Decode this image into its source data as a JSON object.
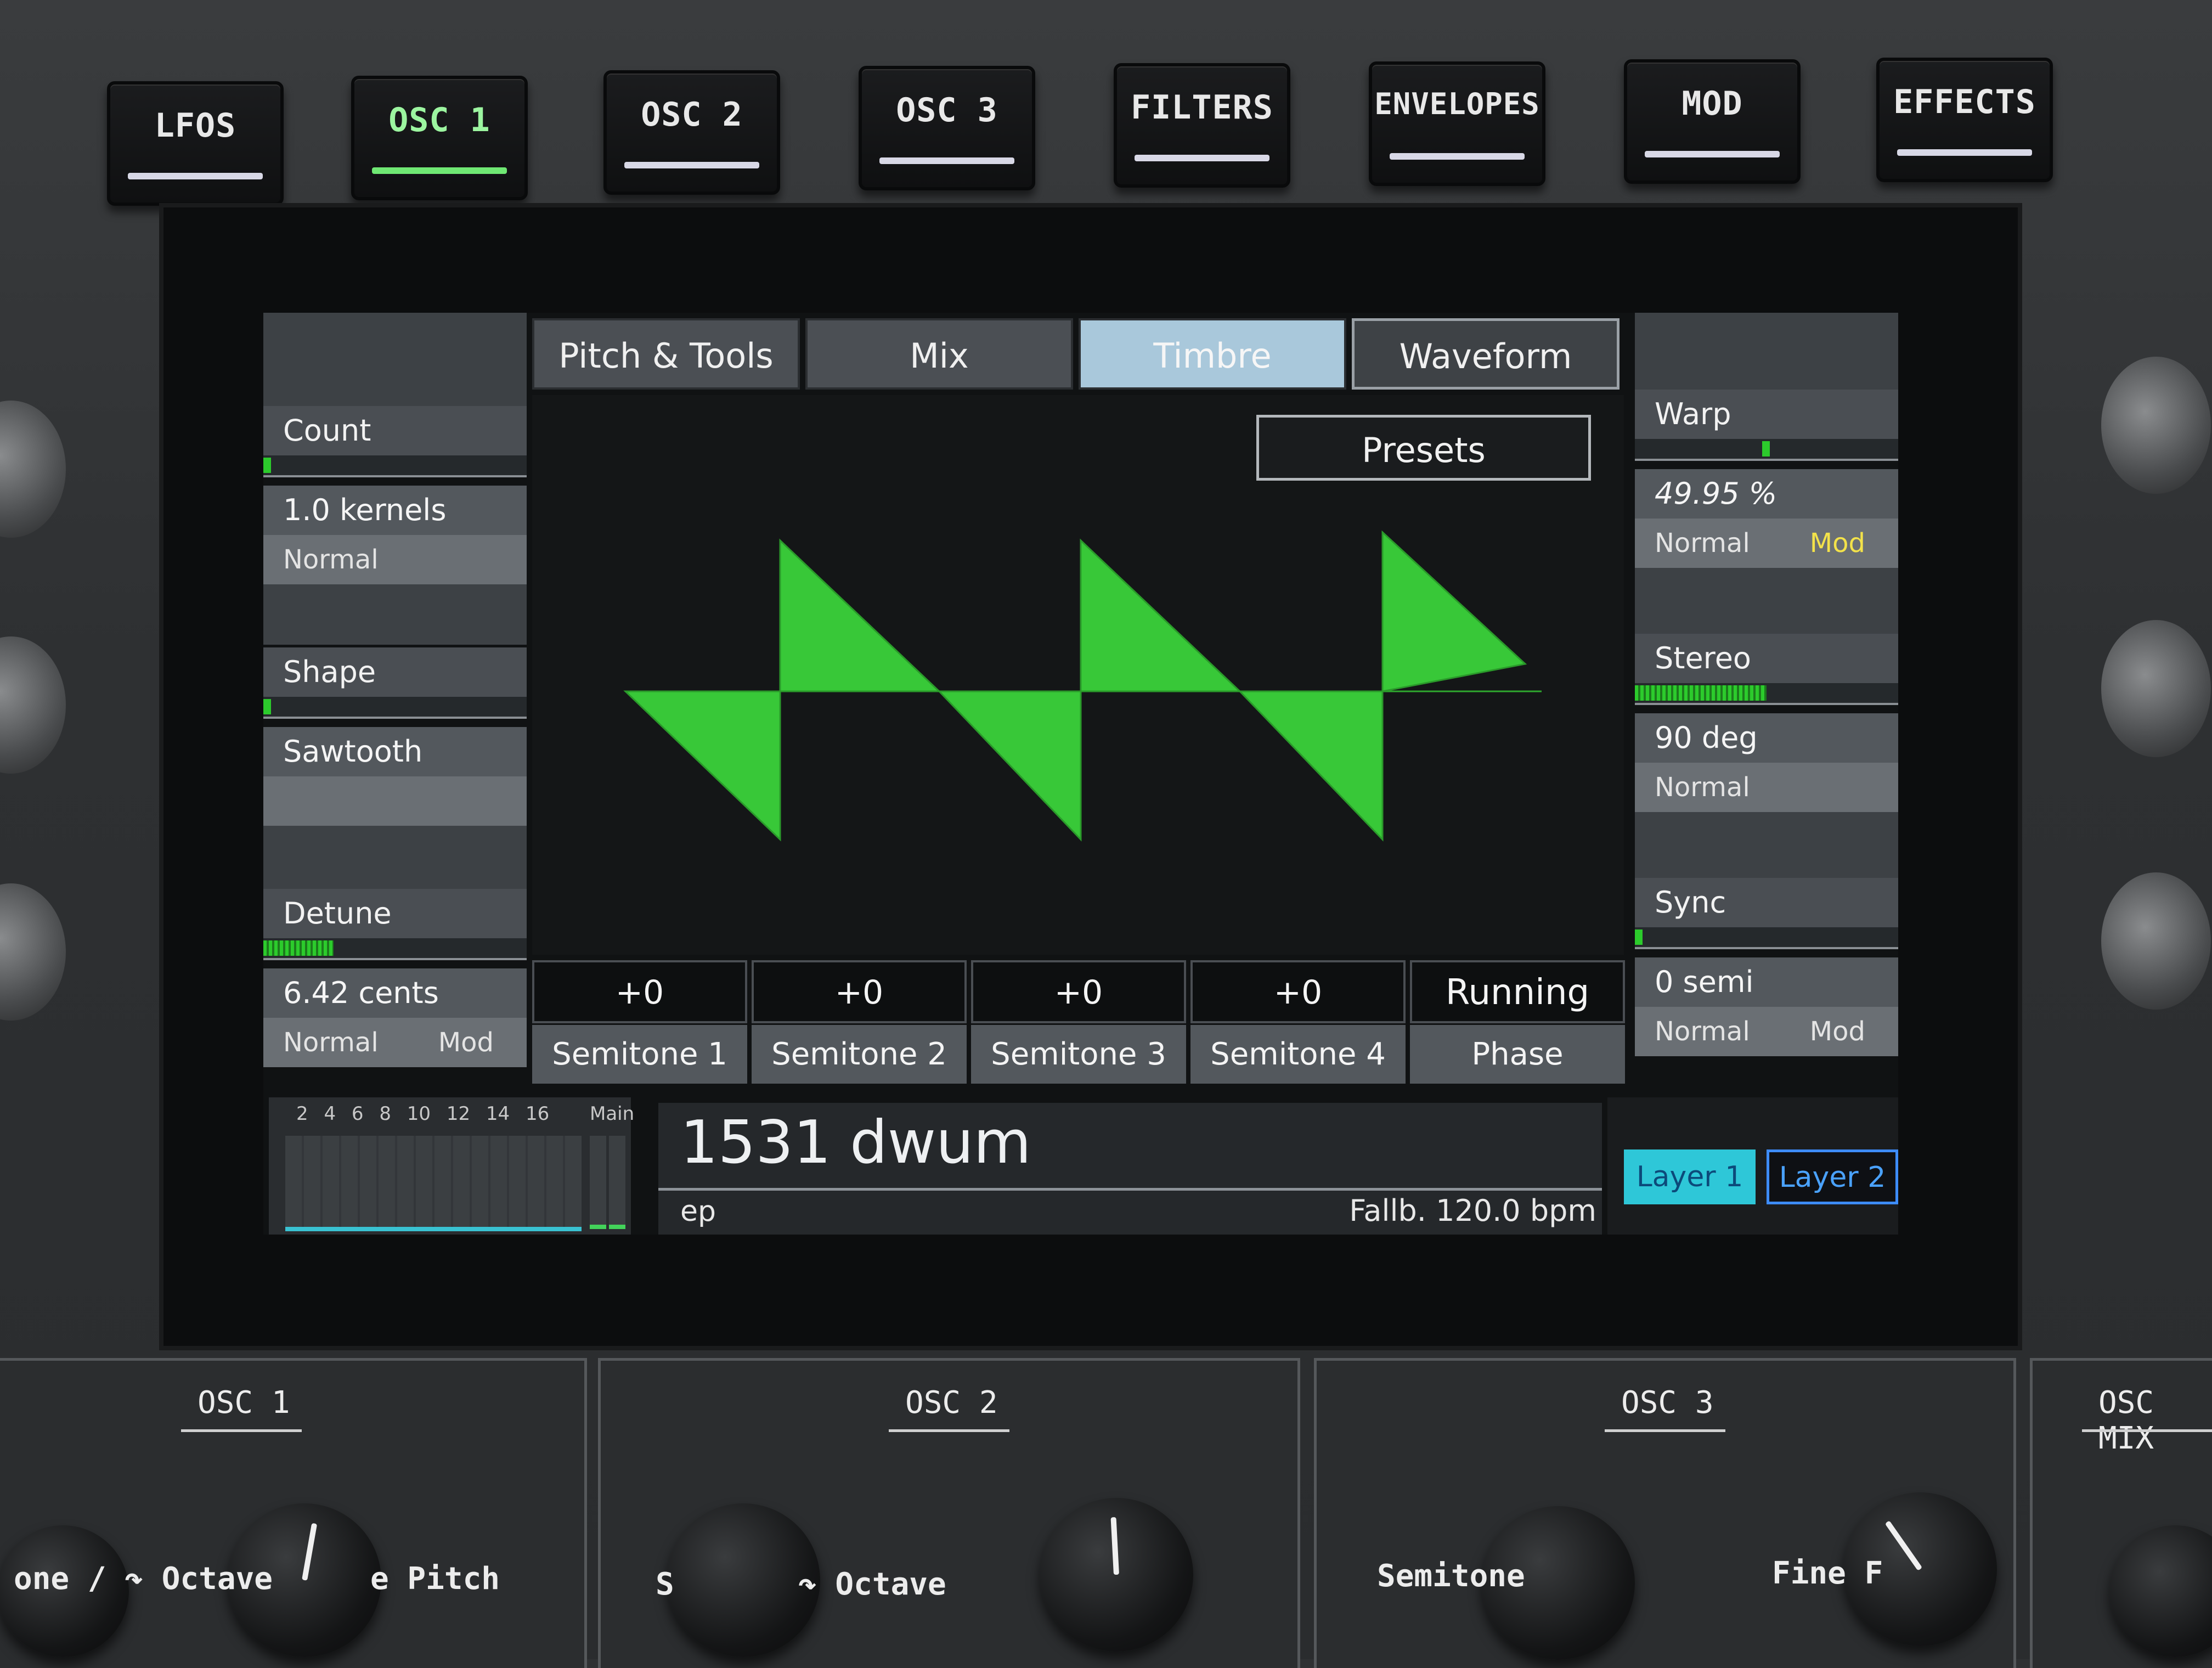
{
  "mode_buttons": [
    {
      "label": "LFOS",
      "active": false
    },
    {
      "label": "OSC 1",
      "active": true
    },
    {
      "label": "OSC 2",
      "active": false
    },
    {
      "label": "OSC 3",
      "active": false
    },
    {
      "label": "FILTERS",
      "active": false
    },
    {
      "label": "ENVELOPES",
      "active": false
    },
    {
      "label": "MOD",
      "active": false
    },
    {
      "label": "EFFECTS",
      "active": false
    }
  ],
  "tabs": [
    {
      "label": "Pitch & Tools"
    },
    {
      "label": "Mix"
    },
    {
      "label": "Timbre"
    },
    {
      "label": "Waveform"
    }
  ],
  "active_tab": "Timbre",
  "presets_label": "Presets",
  "left_params": [
    {
      "title": "Count",
      "value": "1.0 kernels",
      "mode": "Normal",
      "mod": "",
      "level": 0.0
    },
    {
      "title": "Shape",
      "value": "Sawtooth",
      "mode": "",
      "mod": "",
      "level": 0.0
    },
    {
      "title": "Detune",
      "value": "6.42 cents",
      "mode": "Normal",
      "mod": "Mod",
      "level": 0.27
    }
  ],
  "right_params": [
    {
      "title": "Warp",
      "value": "49.95 %",
      "mode": "Normal",
      "mod": "Mod",
      "level": 0.4995
    },
    {
      "title": "Stereo",
      "value": "90 deg",
      "mode": "Normal",
      "mod": "",
      "level": 0.5
    },
    {
      "title": "Sync",
      "value": "0 semi",
      "mode": "Normal",
      "mod": "Mod",
      "level": 0.0
    }
  ],
  "semitones": [
    {
      "value": "+0",
      "name": "Semitone 1"
    },
    {
      "value": "+0",
      "name": "Semitone 2"
    },
    {
      "value": "+0",
      "name": "Semitone 3"
    },
    {
      "value": "+0",
      "name": "Semitone 4"
    },
    {
      "value": "Running",
      "name": "Phase"
    }
  ],
  "meters": {
    "channels": "2 4 6 8 10 12 14 16",
    "main_label": "Main"
  },
  "preset": {
    "name": "1531 dwum",
    "sub": "ep",
    "tempo": "Fallb. 120.0 bpm"
  },
  "layers": [
    {
      "label": "Layer 1",
      "active": true
    },
    {
      "label": "Layer 2",
      "active": false
    }
  ],
  "bottom_sections": [
    {
      "title": "OSC 1",
      "labels": [
        "one / ↷ Octave",
        "e Pitch"
      ]
    },
    {
      "title": "OSC 2",
      "labels": [
        "S",
        "↷ Octave"
      ]
    },
    {
      "title": "OSC 3",
      "labels": [
        "Semitone",
        "Fine F"
      ]
    },
    {
      "title": "OSC MIX",
      "labels": []
    }
  ],
  "colors": {
    "wave": "#38c838",
    "accent_green": "#6fe873",
    "layer_active": "#2ec7d8",
    "mod_yellow": "#f3e24a"
  }
}
